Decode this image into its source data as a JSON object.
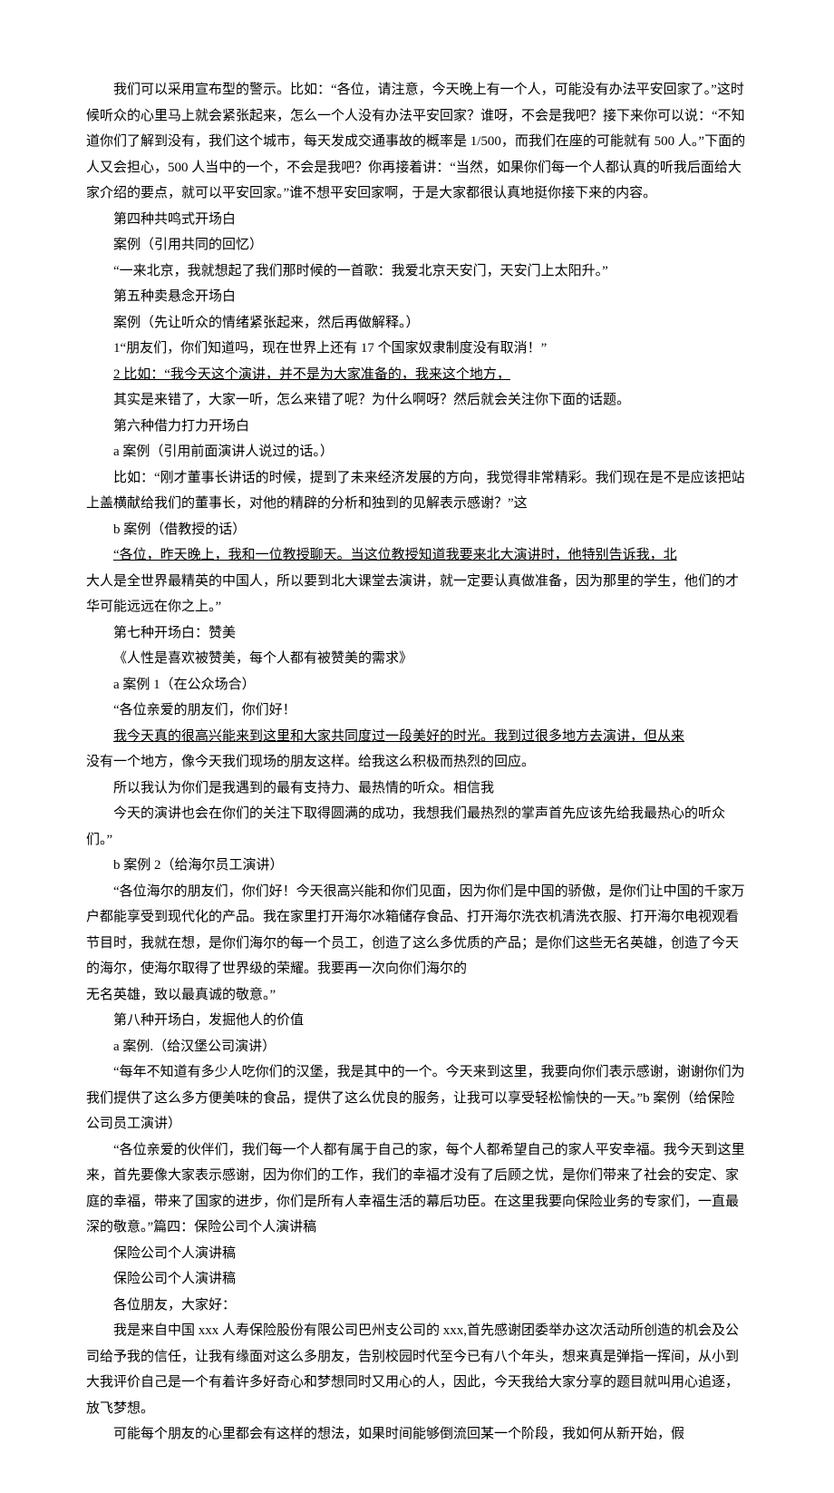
{
  "paragraphs": [
    {
      "text": "我们可以采用宣布型的警示。比如：“各位，请注意，今天晚上有一个人，可能没有办法平安回家了。”这时候听众的心里马上就会紧张起来，怎么一个人没有办法平安回家？谁呀，不会是我吧？接下来你可以说：“不知道你们了解到没有，我们这个城市，每天发成交通事故的概率是 1/500，而我们在座的可能就有 500 人。”下面的人又会担心，500 人当中的一个，不会是我吧？你再接着讲：“当然，如果你们每一个人都认真的听我后面给大家介绍的要点，就可以平安回家。”谁不想平安回家啊，于是大家都很认真地挺你接下来的内容。",
      "underline": false
    },
    {
      "text": "第四种共鸣式开场白",
      "underline": false
    },
    {
      "text": "案例（引用共同的回忆）",
      "underline": false
    },
    {
      "text": "“一来北京，我就想起了我们那时候的一首歌：我爱北京天安门，天安门上太阳升。”",
      "underline": false
    },
    {
      "text": "第五种卖悬念开场白",
      "underline": false
    },
    {
      "text": "案例（先让听众的情绪紧张起来，然后再做解释。）",
      "underline": false
    },
    {
      "text": "1“朋友们，你们知道吗，现在世界上还有 17 个国家奴隶制度没有取消！”",
      "underline": false
    },
    {
      "text": "2 比如：“我今天这个演讲，并不是为大家准备的，我来这个地方，",
      "underline": true
    },
    {
      "text": "其实是来错了，大家一听，怎么来错了呢？为什么啊呀？然后就会关注你下面的话题。",
      "underline": false
    },
    {
      "text": "第六种借力打力开场白",
      "underline": false
    },
    {
      "text": "a 案例（引用前面演讲人说过的话。）",
      "underline": false
    },
    {
      "text": "比如：“刚才董事长讲话的时候，提到了未来经济发展的方向，我觉得非常精彩。我们现在是不是应该把站上盖横献给我们的董事长，对他的精辟的分析和独到的见解表示感谢？”这",
      "underline": false
    },
    {
      "text": "b 案例（借教授的话）",
      "underline": false
    },
    {
      "text": "“各位，昨天晚上，我和一位教授聊天。当这位教授知道我要来北大演讲时，他特别告诉我，北",
      "underline": true
    },
    {
      "text": "大人是全世界最精英的中国人，所以要到北大课堂去演讲，就一定要认真做准备，因为那里的学生，他们的才华可能远远在你之上。”",
      "underline": false,
      "noindent": true
    },
    {
      "text": "第七种开场白：赞美",
      "underline": false
    },
    {
      "text": "《人性是喜欢被赞美，每个人都有被赞美的需求》",
      "underline": false
    },
    {
      "text": "a 案例 1（在公众场合）",
      "underline": false
    },
    {
      "text": "“各位亲爱的朋友们，你们好！",
      "underline": false
    },
    {
      "text": "我今天真的很高兴能来到这里和大家共同度过一段美好的时光。我到过很多地方去演讲，但从来",
      "underline": true
    },
    {
      "text": "没有一个地方，像今天我们现场的朋友这样。给我这么积极而热烈的回应。",
      "underline": false,
      "noindent": true
    },
    {
      "text": "所以我认为你们是我遇到的最有支持力、最热情的听众。相信我",
      "underline": false
    },
    {
      "text": "今天的演讲也会在你们的关注下取得圆满的成功，我想我们最热烈的掌声首先应该先给我最热心的听众们。”",
      "underline": false
    },
    {
      "text": "b 案例 2（给海尔员工演讲）",
      "underline": false
    },
    {
      "text": "“各位海尔的朋友们，你们好！今天很高兴能和你们见面，因为你们是中国的骄傲，是你们让中国的千家万户都能享受到现代化的产品。我在家里打开海尔冰箱储存食品、打开海尔洗衣机清洗衣服、打开海尔电视观看节目时，我就在想，是你们海尔的每一个员工，创造了这么多优质的产品；是你们这些无名英雄，创造了今天的海尔，使海尔取得了世界级的荣耀。我要再一次向你们海尔的",
      "underline": false
    },
    {
      "text": "无名英雄，致以最真诚的敬意。”",
      "underline": false,
      "noindent": true
    },
    {
      "text": "第八种开场白，发掘他人的价值",
      "underline": false
    },
    {
      "text": "a 案例.（给汉堡公司演讲）",
      "underline": false
    },
    {
      "text": "“每年不知道有多少人吃你们的汉堡，我是其中的一个。今天来到这里，我要向你们表示感谢，谢谢你们为我们提供了这么多方便美味的食品，提供了这么优良的服务，让我可以享受轻松愉快的一天。”b 案例（给保险公司员工演讲）",
      "underline": false
    },
    {
      "text": "“各位亲爱的伙伴们，我们每一个人都有属于自己的家，每个人都希望自己的家人平安幸福。我今天到这里来，首先要像大家表示感谢，因为你们的工作，我们的幸福才没有了后顾之忧，是你们带来了社会的安定、家庭的幸福，带来了国家的进步，你们是所有人幸福生活的幕后功臣。在这里我要向保险业务的专家们，一直最深的敬意。”篇四：保险公司个人演讲稿",
      "underline": false
    },
    {
      "text": "保险公司个人演讲稿",
      "underline": false
    },
    {
      "text": "保险公司个人演讲稿",
      "underline": false
    },
    {
      "text": "各位朋友，大家好：",
      "underline": false
    },
    {
      "text": "我是来自中国 xxx 人寿保险股份有限公司巴州支公司的 xxx,首先感谢团委举办这次活动所创造的机会及公司给予我的信任，让我有缘面对这么多朋友，告别校园时代至今已有八个年头，想来真是弹指一挥间，从小到大我评价自己是一个有着许多好奇心和梦想同时又用心的人，因此，今天我给大家分享的题目就叫用心追逐，放飞梦想。",
      "underline": false
    },
    {
      "text": "可能每个朋友的心里都会有这样的想法，如果时间能够倒流回某一个阶段，我如何从新开始，假",
      "underline": false
    }
  ]
}
